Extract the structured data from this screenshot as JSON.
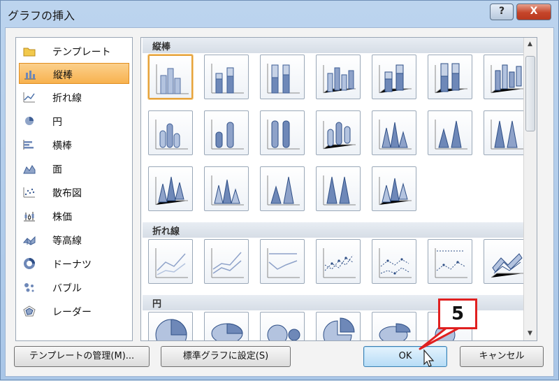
{
  "window": {
    "title": "グラフの挿入",
    "help_label": "?",
    "close_label": "X"
  },
  "categories": [
    {
      "label": "テンプレート",
      "icon": "folder-icon",
      "selected": false
    },
    {
      "label": "縦棒",
      "icon": "column-chart-icon",
      "selected": true
    },
    {
      "label": "折れ線",
      "icon": "line-chart-icon",
      "selected": false
    },
    {
      "label": "円",
      "icon": "pie-chart-icon",
      "selected": false
    },
    {
      "label": "横棒",
      "icon": "bar-chart-icon",
      "selected": false
    },
    {
      "label": "面",
      "icon": "area-chart-icon",
      "selected": false
    },
    {
      "label": "散布図",
      "icon": "scatter-chart-icon",
      "selected": false
    },
    {
      "label": "株価",
      "icon": "stock-chart-icon",
      "selected": false
    },
    {
      "label": "等高線",
      "icon": "surface-chart-icon",
      "selected": false
    },
    {
      "label": "ドーナツ",
      "icon": "doughnut-chart-icon",
      "selected": false
    },
    {
      "label": "バブル",
      "icon": "bubble-chart-icon",
      "selected": false
    },
    {
      "label": "レーダー",
      "icon": "radar-chart-icon",
      "selected": false
    }
  ],
  "sections": [
    {
      "label": "縦棒"
    },
    {
      "label": "折れ線"
    },
    {
      "label": "円"
    }
  ],
  "buttons": {
    "manage_templates": "テンプレートの管理(M)...",
    "set_default": "標準グラフに設定(S)",
    "ok": "OK",
    "cancel": "キャンセル"
  },
  "callout": {
    "number": "5"
  },
  "colors": {
    "accent": "#e02020",
    "selection": "#f8b24f",
    "ok_button": "#b7dcf6",
    "chart_blue": "#6e88b8"
  }
}
